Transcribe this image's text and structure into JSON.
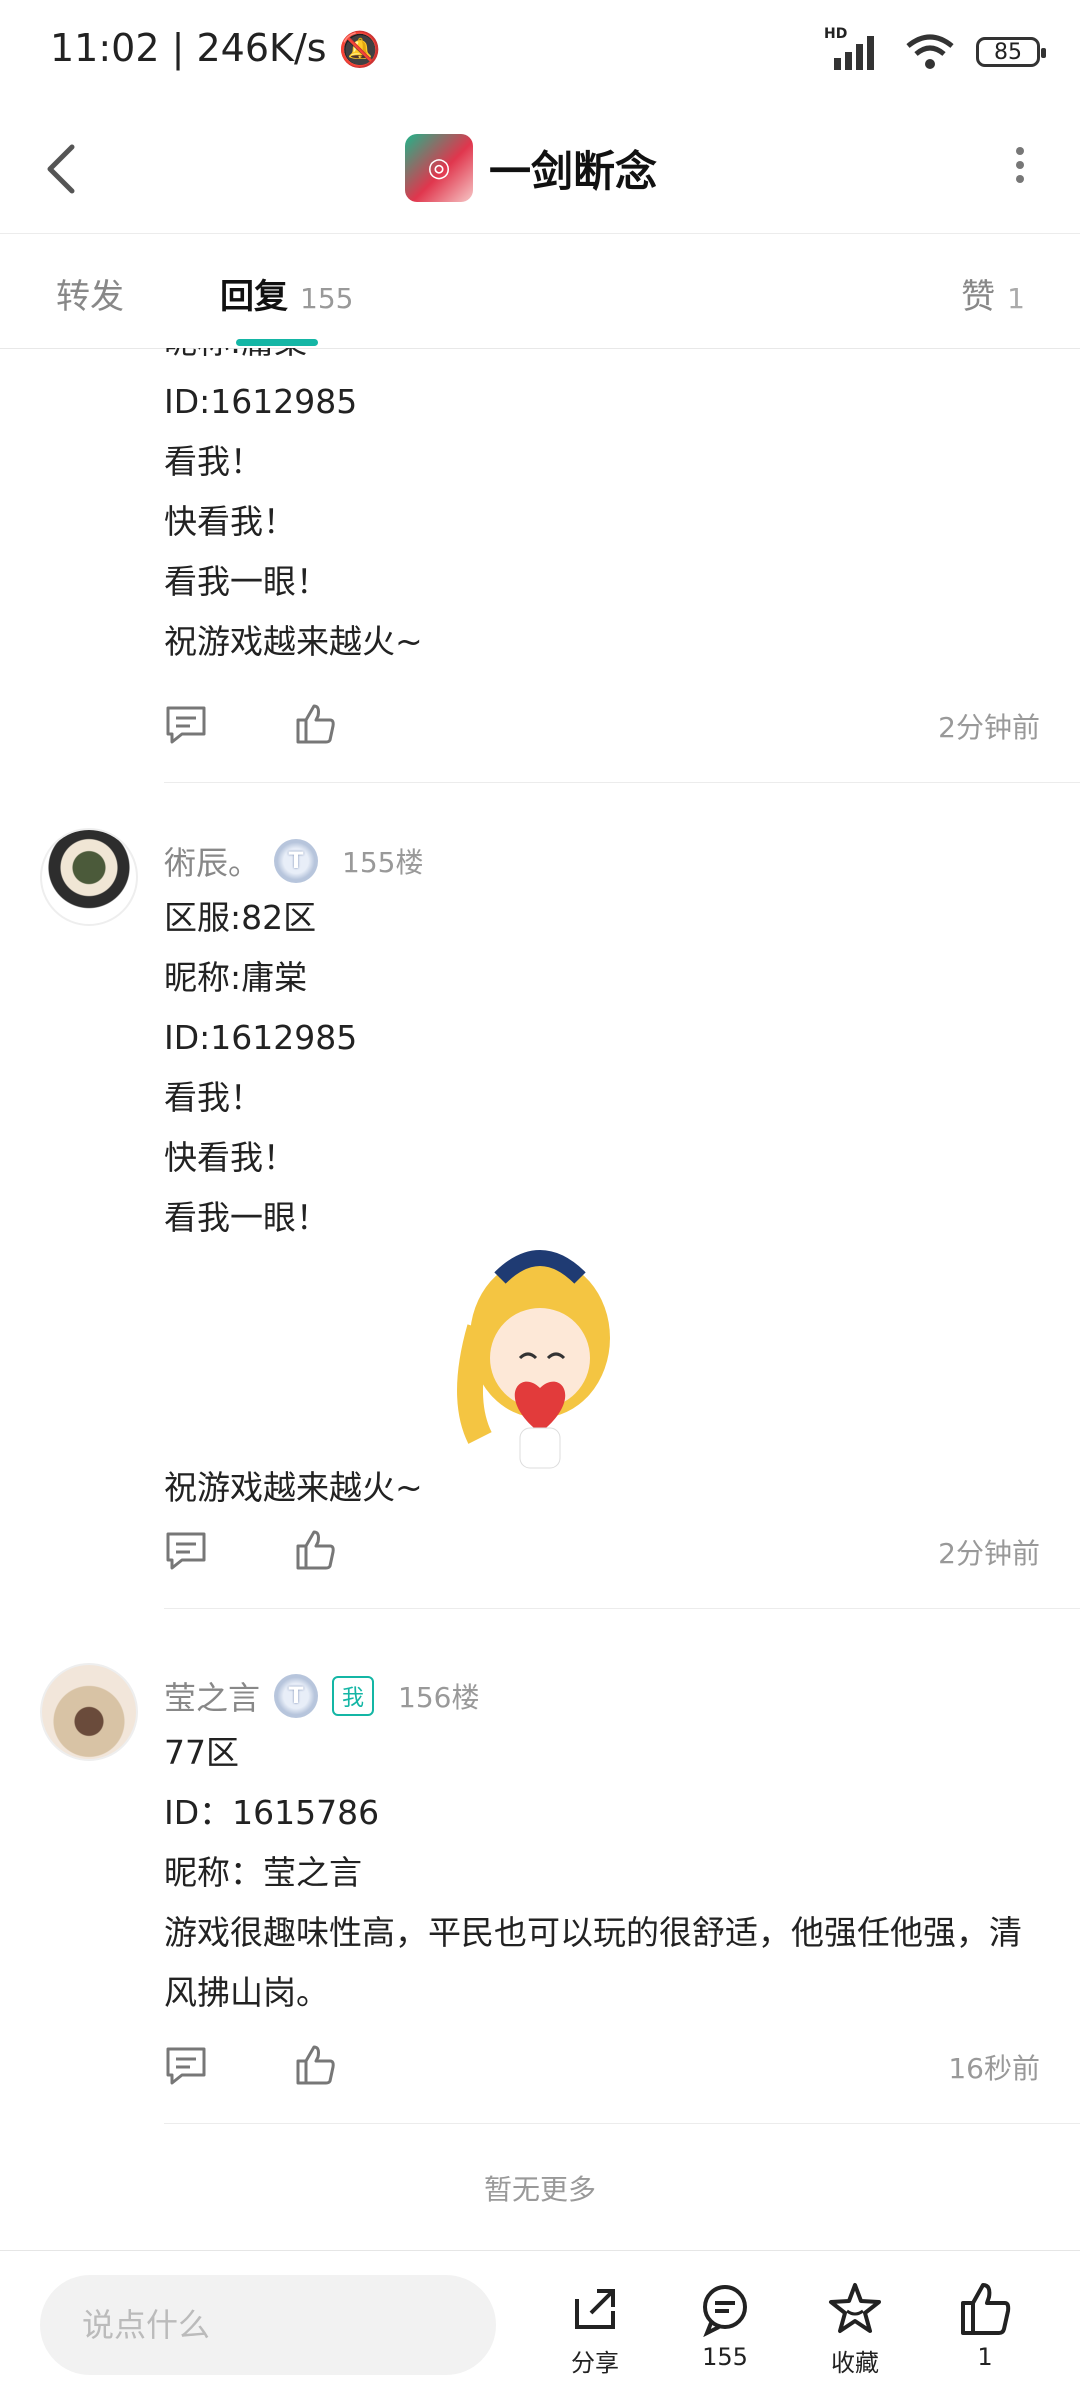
{
  "status": {
    "time": "11:02",
    "speed": "246K/s",
    "network": "HD",
    "battery": "85"
  },
  "header": {
    "title": "一剑断念"
  },
  "tabs": {
    "forward": "转发",
    "reply": "回复",
    "reply_count": "155",
    "like": "赞",
    "like_count": "1"
  },
  "top_partial": {
    "lines": [
      "昵称:庸棠",
      "ID:1612985",
      "看我！",
      "快看我！",
      "看我一眼！",
      "祝游戏越来越火~"
    ],
    "time": "2分钟前"
  },
  "replies": [
    {
      "username": "術辰。",
      "level": "T",
      "floor": "155楼",
      "lines": [
        "区服:82区",
        "昵称:庸棠",
        "ID:1612985",
        "看我！",
        "快看我！",
        "看我一眼！",
        "祝游戏越来越火~"
      ],
      "time": "2分钟前"
    },
    {
      "username": "莹之言",
      "level": "T",
      "me_badge": "我",
      "floor": "156楼",
      "lines": [
        "77区",
        "ID：1615786",
        "昵称：莹之言",
        "游戏很趣味性高，平民也可以玩的很舒适，他强任他强，清",
        "风拂山岗。"
      ],
      "time": "16秒前"
    }
  ],
  "no_more": "暂无更多",
  "bottom": {
    "placeholder": "说点什么",
    "share": "分享",
    "comments": "155",
    "favorite": "收藏",
    "likes": "1"
  }
}
